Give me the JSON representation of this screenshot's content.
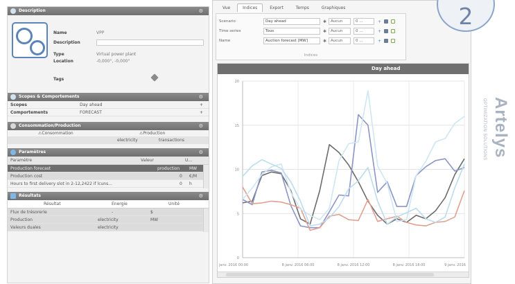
{
  "description": {
    "header": "Description",
    "name_label": "Name",
    "name_value": "VPP",
    "desc_label": "Description",
    "type_label": "Type",
    "type_value": "Virtual power plant",
    "location_label": "Location",
    "location_value": "-0,000°, -0,000°",
    "tags_label": "Tags"
  },
  "scopes": {
    "header": "Scopes & Comportements",
    "rows": [
      {
        "label": "Scopes",
        "value": "Day ahead"
      },
      {
        "label": "Comportements",
        "value": "FORECAST"
      }
    ]
  },
  "consumption": {
    "header": "Consommation/Production",
    "col1": "Consommation",
    "col2": "Production",
    "cell_a": "electricity",
    "cell_b": "transactions"
  },
  "parameters": {
    "header": "Paramètres",
    "columns": [
      "Paramètre",
      "Valeur",
      "U..."
    ],
    "rows": [
      {
        "name": "Production forecast",
        "value": "production",
        "unit": "MW",
        "selected": true
      },
      {
        "name": "Production cost",
        "value": "0",
        "unit": "€/M",
        "selected": false
      },
      {
        "name": "Hours to first delivery slot in 2-12,2422 if lcuns...",
        "value": "0",
        "unit": "h",
        "selected": false
      }
    ]
  },
  "results": {
    "header": "Résultats",
    "columns": [
      "Résultat",
      "Energie",
      "Unité"
    ],
    "rows": [
      {
        "name": "Flux de trésorerie",
        "energy": "-",
        "unit": "$"
      },
      {
        "name": "Production",
        "energy": "electricity",
        "unit": "MW"
      },
      {
        "name": "Valeurs duales",
        "energy": "electricity",
        "unit": ""
      }
    ]
  },
  "tabs": [
    "Vue",
    "Indices",
    "Export",
    "Temps",
    "Graphiques"
  ],
  "indices": {
    "rows": [
      {
        "key": "Scenario",
        "value": "Day ahead",
        "agg": "Aucun",
        "range": "0 ..."
      },
      {
        "key": "Time series",
        "value": "Tous",
        "agg": "Aucun",
        "range": "0 ..."
      },
      {
        "key": "Name",
        "value": "Auction forecast [MW]",
        "agg": "Aucun",
        "range": "0 ..."
      }
    ],
    "footer": "Indices"
  },
  "chart_data": {
    "type": "line",
    "title": "Day ahead",
    "ylim": [
      0,
      20
    ],
    "yticks": [
      "0",
      "5",
      "10",
      "15",
      "20"
    ],
    "x": [
      0,
      1,
      2,
      3,
      4,
      5,
      6,
      7,
      8,
      9,
      10,
      11,
      12,
      13,
      14,
      15,
      16,
      17,
      18,
      19,
      20,
      21,
      22,
      23
    ],
    "xtick_labels": [
      "janv. 2016 00:00",
      "8 janv. 2016 06:00",
      "8 janv. 2016 12:00",
      "8 janv. 2016 18:00",
      "9 janv. 2016"
    ],
    "series": [
      {
        "values": [
          6.2,
          6.4,
          9.3,
          9.7,
          9.5,
          7.6,
          4.4,
          3.8,
          7.6,
          12.8,
          11.9,
          10.5,
          8.6,
          6.4,
          4.8,
          3.8,
          4.4,
          4.0,
          4.8,
          4.4,
          5.3,
          6.8,
          9.4,
          11.2
        ],
        "color": "#6c6c6c"
      },
      {
        "values": [
          6.6,
          6.0,
          9.7,
          9.9,
          9.6,
          5.9,
          3.6,
          3.4,
          3.4,
          5.2,
          7.1,
          7.0,
          16.2,
          15.0,
          7.4,
          8.6,
          5.8,
          5.8,
          9.3,
          10.3,
          11.0,
          11.2,
          9.8,
          10.2
        ],
        "color": "#8c96c6"
      },
      {
        "values": [
          8.0,
          6.1,
          6.2,
          6.4,
          6.3,
          6.0,
          5.6,
          3.1,
          3.4,
          4.7,
          4.9,
          4.3,
          4.2,
          6.6,
          4.1,
          4.4,
          4.7,
          4.0,
          3.7,
          3.6,
          4.0,
          4.1,
          4.6,
          7.6
        ],
        "color": "#e0a092"
      },
      {
        "values": [
          6.6,
          7.9,
          9.4,
          10.3,
          10.6,
          7.4,
          5.5,
          4.8,
          4.3,
          5.6,
          11.0,
          12.9,
          13.1,
          18.9,
          10.4,
          8.4,
          4.1,
          4.3,
          9.3,
          10.9,
          13.1,
          13.5,
          15.2,
          16.0
        ],
        "color": "#cfe6f3"
      },
      {
        "values": [
          9.2,
          10.4,
          11.1,
          10.6,
          10.1,
          8.6,
          6.4,
          3.6,
          3.8,
          4.5,
          5.8,
          7.8,
          8.7,
          10.2,
          6.4,
          3.8,
          4.6,
          5.1,
          5.6,
          4.4,
          4.0,
          4.6,
          7.9,
          10.6
        ],
        "color": "#bcdcee"
      }
    ]
  },
  "badge": "2",
  "brand": {
    "name": "Artelys",
    "tagline": "OPTIMIZATION SOLUTIONS"
  }
}
